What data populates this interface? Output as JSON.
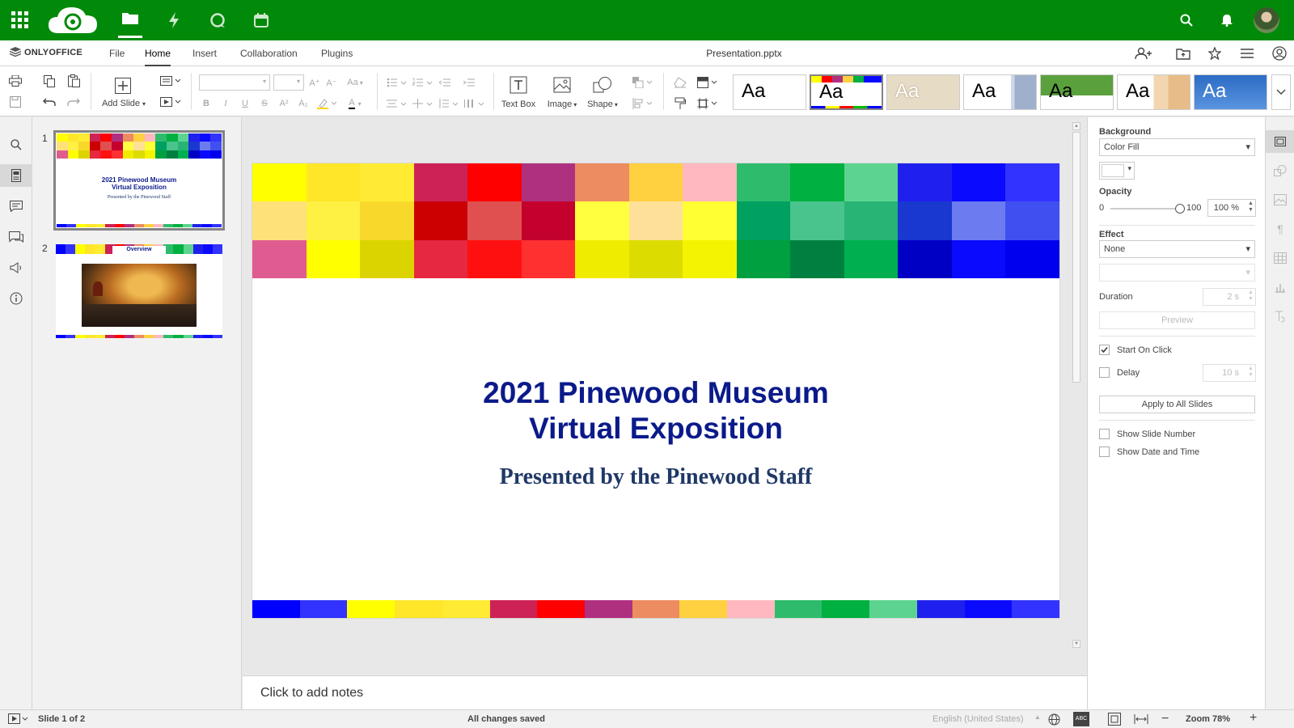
{
  "topbar": {
    "icons": [
      "apps-grid-icon",
      "nextcloud-logo",
      "files-icon",
      "activity-icon",
      "talk-icon",
      "calendar-icon",
      "search-icon",
      "notifications-icon",
      "avatar"
    ]
  },
  "tabs": {
    "brand": "ONLYOFFICE",
    "items": [
      {
        "label": "File"
      },
      {
        "label": "Home"
      },
      {
        "label": "Insert"
      },
      {
        "label": "Collaboration"
      },
      {
        "label": "Plugins"
      }
    ],
    "active": "Home",
    "filename": "Presentation.pptx"
  },
  "toolbar": {
    "add_slide": "Add Slide",
    "text_box": "Text Box",
    "image": "Image",
    "shape": "Shape",
    "bold": "B",
    "italic": "I",
    "underline": "U",
    "strike": "S",
    "superscript": "A²",
    "subscript": "A₂",
    "font_color": "A",
    "font_grow": "A⁺",
    "font_shrink": "A⁻",
    "change_case": "Aa",
    "theme_sample": "Aa"
  },
  "thumbnails": [
    {
      "number": "1",
      "title": "2021 Pinewood Museum\nVirtual Exposition",
      "subtitle": "Presented by the Pinewood Staff"
    },
    {
      "number": "2",
      "title": "Overview"
    }
  ],
  "slide": {
    "title_line1": "2021 Pinewood Museum",
    "title_line2": "Virtual Exposition",
    "subtitle": "Presented by the Pinewood Staff",
    "mosaic_colors": [
      "#ffff00",
      "#ffe629",
      "#ffeb33",
      "#cc2255",
      "#ff0000",
      "#b03080",
      "#ec8c60",
      "#ffd040",
      "#ffb8c0",
      "#2ebc6c",
      "#00b040",
      "#5cd490",
      "#2020ee",
      "#0a0aff",
      "#3333ff",
      "#ffe17a",
      "#fff044",
      "#f8d82a",
      "#cc0000",
      "#e05050",
      "#c4002e",
      "#ffff40",
      "#ffe098",
      "#ffff33",
      "#00a060",
      "#48c48c",
      "#28b474",
      "#1838d0",
      "#6c7cf0",
      "#4050f0",
      "#e05c90",
      "#ffff00",
      "#dcd400",
      "#e62840",
      "#ff1010",
      "#ff3030",
      "#f0ec00",
      "#dcdc00",
      "#f4f400",
      "#00a040",
      "#008040",
      "#00b050",
      "#0000c4",
      "#0a0aff",
      "#0000ee"
    ],
    "bottom_colors": [
      "#0000ff",
      "#3333ff",
      "#ffff00",
      "#ffe629",
      "#ffeb33",
      "#cc2255",
      "#ff0000",
      "#b03080",
      "#ec8c60",
      "#ffd040",
      "#ffb8c0",
      "#2ebc6c",
      "#00b040",
      "#5cd490",
      "#2020ee",
      "#0a0aff",
      "#3333ff"
    ]
  },
  "notes": {
    "placeholder": "Click to add notes"
  },
  "right_panel": {
    "background_label": "Background",
    "background_value": "Color Fill",
    "opacity_label": "Opacity",
    "opacity_min": "0",
    "opacity_max": "100",
    "opacity_value": "100 %",
    "effect_label": "Effect",
    "effect_value": "None",
    "duration_label": "Duration",
    "duration_value": "2 s",
    "preview_label": "Preview",
    "start_on_click": "Start On Click",
    "delay_label": "Delay",
    "delay_value": "10 s",
    "apply_all": "Apply to All Slides",
    "show_slide_number": "Show Slide Number",
    "show_date_time": "Show Date and Time"
  },
  "status": {
    "slide_counter": "Slide 1 of 2",
    "save_state": "All changes saved",
    "language": "English (United States)",
    "zoom": "Zoom 78%"
  }
}
